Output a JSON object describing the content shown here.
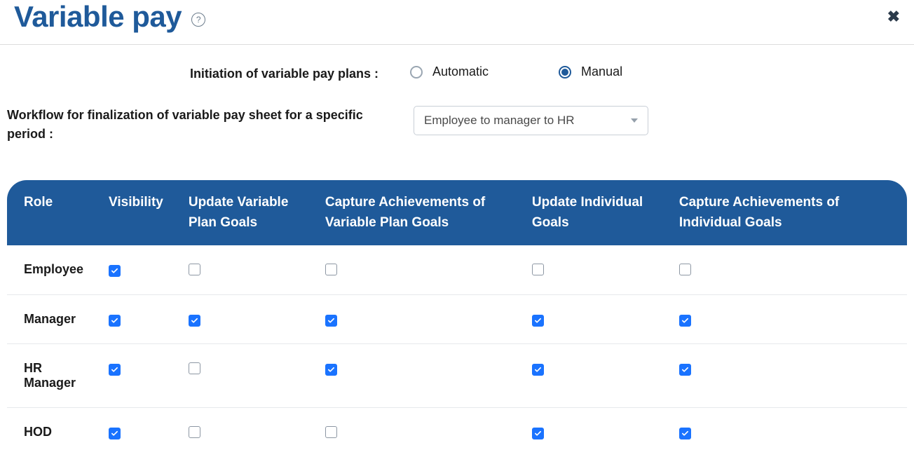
{
  "header": {
    "title": "Variable pay",
    "help_glyph": "?",
    "close_glyph": "✖"
  },
  "form": {
    "initiation_label": "Initiation of variable pay plans :",
    "radio_automatic": "Automatic",
    "radio_manual": "Manual",
    "initiation_selected": "manual",
    "workflow_label": "Workflow for finalization of variable pay sheet for a specific period :",
    "workflow_selected": "Employee to manager to HR"
  },
  "table": {
    "headers": {
      "role": "Role",
      "visibility": "Visibility",
      "updateVarGoals": "Update Variable Plan Goals",
      "captureVarGoals": "Capture Achievements of Variable Plan Goals",
      "updateIndGoals": "Update Individual Goals",
      "captureIndGoals": "Capture Achievements of Individual Goals"
    },
    "rows": [
      {
        "role": "Employee",
        "visibility": true,
        "updateVarGoals": false,
        "captureVarGoals": false,
        "updateIndGoals": false,
        "captureIndGoals": false
      },
      {
        "role": "Manager",
        "visibility": true,
        "updateVarGoals": true,
        "captureVarGoals": true,
        "updateIndGoals": true,
        "captureIndGoals": true
      },
      {
        "role": "HR Manager",
        "visibility": true,
        "updateVarGoals": false,
        "captureVarGoals": true,
        "updateIndGoals": true,
        "captureIndGoals": true
      },
      {
        "role": "HOD",
        "visibility": true,
        "updateVarGoals": false,
        "captureVarGoals": false,
        "updateIndGoals": true,
        "captureIndGoals": true
      }
    ]
  }
}
